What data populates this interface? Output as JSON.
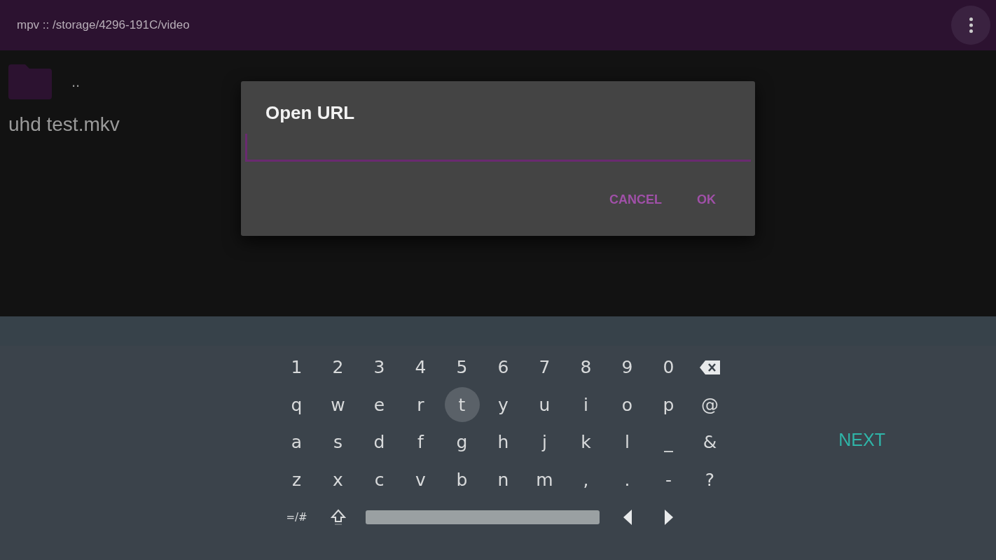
{
  "app_bar": {
    "title": "mpv :: /storage/4296-191C/video"
  },
  "file_list": [
    {
      "kind": "folder",
      "name": ".."
    },
    {
      "kind": "file",
      "name": "uhd test.mkv"
    }
  ],
  "dialog": {
    "title": "Open URL",
    "buttons": [
      "CANCEL",
      "OK"
    ]
  },
  "keyboard": {
    "rows": [
      [
        {
          "kind": "char",
          "label": "1",
          "selected": false
        },
        {
          "kind": "char",
          "label": "2",
          "selected": false
        },
        {
          "kind": "char",
          "label": "3",
          "selected": false
        },
        {
          "kind": "char",
          "label": "4",
          "selected": false
        },
        {
          "kind": "char",
          "label": "5",
          "selected": false
        },
        {
          "kind": "char",
          "label": "6",
          "selected": false
        },
        {
          "kind": "char",
          "label": "7",
          "selected": false
        },
        {
          "kind": "char",
          "label": "8",
          "selected": false
        },
        {
          "kind": "char",
          "label": "9",
          "selected": false
        },
        {
          "kind": "char",
          "label": "0",
          "selected": false
        },
        {
          "kind": "backspace",
          "selected": false
        }
      ],
      [
        {
          "kind": "char",
          "label": "q",
          "selected": false
        },
        {
          "kind": "char",
          "label": "w",
          "selected": false
        },
        {
          "kind": "char",
          "label": "e",
          "selected": false
        },
        {
          "kind": "char",
          "label": "r",
          "selected": false
        },
        {
          "kind": "char",
          "label": "t",
          "selected": true
        },
        {
          "kind": "char",
          "label": "y",
          "selected": false
        },
        {
          "kind": "char",
          "label": "u",
          "selected": false
        },
        {
          "kind": "char",
          "label": "i",
          "selected": false
        },
        {
          "kind": "char",
          "label": "o",
          "selected": false
        },
        {
          "kind": "char",
          "label": "p",
          "selected": false
        },
        {
          "kind": "char",
          "label": "@",
          "selected": false
        }
      ],
      [
        {
          "kind": "char",
          "label": "a",
          "selected": false
        },
        {
          "kind": "char",
          "label": "s",
          "selected": false
        },
        {
          "kind": "char",
          "label": "d",
          "selected": false
        },
        {
          "kind": "char",
          "label": "f",
          "selected": false
        },
        {
          "kind": "char",
          "label": "g",
          "selected": false
        },
        {
          "kind": "char",
          "label": "h",
          "selected": false
        },
        {
          "kind": "char",
          "label": "j",
          "selected": false
        },
        {
          "kind": "char",
          "label": "k",
          "selected": false
        },
        {
          "kind": "char",
          "label": "l",
          "selected": false
        },
        {
          "kind": "char",
          "label": "_",
          "selected": false
        },
        {
          "kind": "char",
          "label": "&",
          "selected": false
        }
      ],
      [
        {
          "kind": "char",
          "label": "z",
          "selected": false
        },
        {
          "kind": "char",
          "label": "x",
          "selected": false
        },
        {
          "kind": "char",
          "label": "c",
          "selected": false
        },
        {
          "kind": "char",
          "label": "v",
          "selected": false
        },
        {
          "kind": "char",
          "label": "b",
          "selected": false
        },
        {
          "kind": "char",
          "label": "n",
          "selected": false
        },
        {
          "kind": "char",
          "label": "m",
          "selected": false
        },
        {
          "kind": "char",
          "label": ",",
          "selected": false
        },
        {
          "kind": "char",
          "label": ".",
          "selected": false
        },
        {
          "kind": "char",
          "label": "-",
          "selected": false
        },
        {
          "kind": "char",
          "label": "?",
          "selected": false
        }
      ],
      [
        {
          "kind": "symbols",
          "label": "=/#",
          "selected": false
        },
        {
          "kind": "shift",
          "selected": false
        },
        {
          "kind": "space",
          "selected": false
        },
        {
          "kind": "left",
          "selected": false
        },
        {
          "kind": "right",
          "selected": false
        }
      ]
    ],
    "action": "NEXT"
  }
}
